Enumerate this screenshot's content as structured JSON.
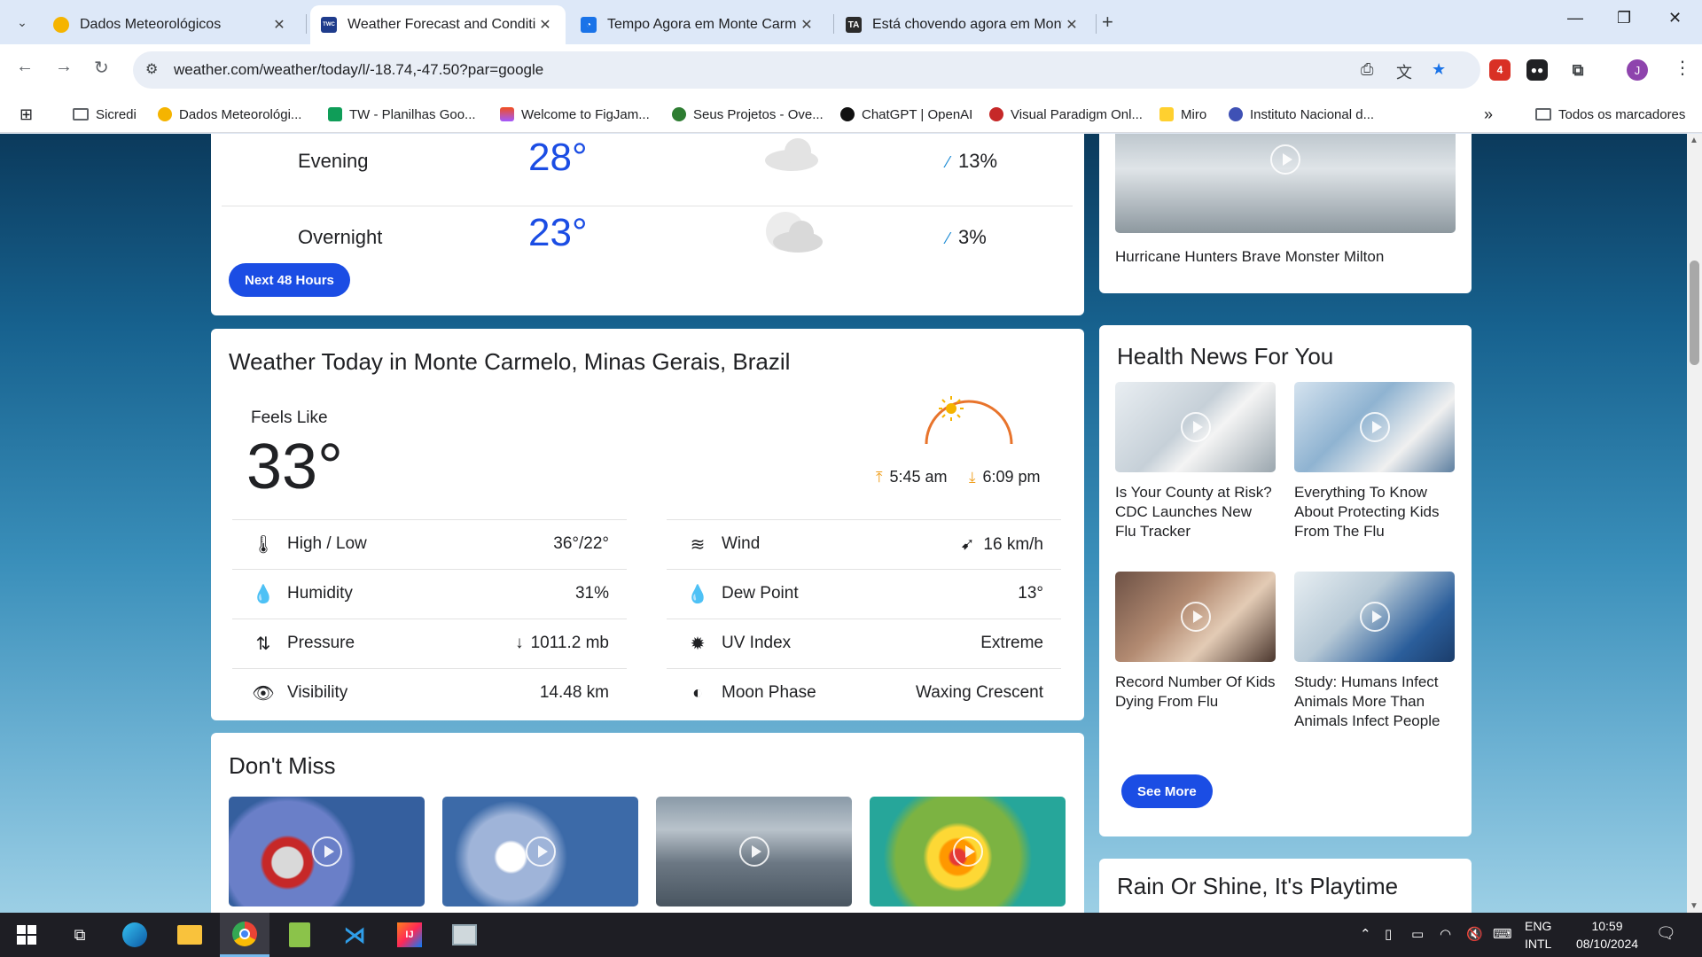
{
  "browser": {
    "tabs": [
      {
        "title": "Dados Meteorológicos",
        "favicon": "sun-cloud-icon",
        "active": false
      },
      {
        "title": "Weather Forecast and Condition",
        "favicon": "weather-channel-icon",
        "active": true
      },
      {
        "title": "Tempo Agora em Monte Carme",
        "favicon": "tempo-agora-icon",
        "active": false
      },
      {
        "title": "Está chovendo agora em Monte",
        "favicon": "ta-icon",
        "active": false
      }
    ],
    "url": "weather.com/weather/today/l/-18.74,-47.50?par=google",
    "bookmarks": [
      {
        "label": "Sicredi"
      },
      {
        "label": "Dados Meteorológi..."
      },
      {
        "label": "TW - Planilhas Goo..."
      },
      {
        "label": "Welcome to FigJam..."
      },
      {
        "label": "Seus Projetos - Ove..."
      },
      {
        "label": "ChatGPT | OpenAI"
      },
      {
        "label": "Visual Paradigm Onl..."
      },
      {
        "label": "Miro"
      },
      {
        "label": "Instituto Nacional d..."
      }
    ],
    "bookmarks_overflow": "»",
    "all_bookmarks": "Todos os marcadores",
    "extension_badge": "4",
    "profile_initial": "J"
  },
  "hourly": {
    "rows": [
      {
        "label": "Evening",
        "temp": "28°",
        "precip": "13%"
      },
      {
        "label": "Overnight",
        "temp": "23°",
        "precip": "3%"
      }
    ],
    "next_button": "Next 48 Hours"
  },
  "today": {
    "title": "Weather Today in Monte Carmelo, Minas Gerais, Brazil",
    "feels_like_label": "Feels Like",
    "feels_like_value": "33°",
    "sunrise": "5:45 am",
    "sunset": "6:09 pm",
    "left_details": [
      {
        "label": "High / Low",
        "value": "36°/22°",
        "icon": "thermometer-icon"
      },
      {
        "label": "Humidity",
        "value": "31%",
        "icon": "humidity-icon"
      },
      {
        "label": "Pressure",
        "value": "1011.2 mb",
        "icon": "pressure-icon"
      },
      {
        "label": "Visibility",
        "value": "14.48 km",
        "icon": "visibility-icon"
      }
    ],
    "right_details": [
      {
        "label": "Wind",
        "value": "16 km/h",
        "icon": "wind-icon"
      },
      {
        "label": "Dew Point",
        "value": "13°",
        "icon": "dew-point-icon"
      },
      {
        "label": "UV Index",
        "value": "Extreme",
        "icon": "uv-index-icon"
      },
      {
        "label": "Moon Phase",
        "value": "Waxing Crescent",
        "icon": "moon-phase-icon"
      }
    ]
  },
  "dont_miss": {
    "title": "Don't Miss"
  },
  "video_card": {
    "caption": "Hurricane Hunters Brave Monster Milton"
  },
  "health": {
    "title": "Health News For You",
    "items": [
      {
        "caption": "Is Your County at Risk? CDC Launches New Flu Tracker"
      },
      {
        "caption": "Everything To Know About Protecting Kids From The Flu"
      },
      {
        "caption": "Record Number Of Kids Dying From Flu"
      },
      {
        "caption": "Study: Humans Infect Animals More Than Animals Infect People"
      }
    ],
    "see_more": "See More"
  },
  "playtime": {
    "title": "Rain Or Shine, It's Playtime"
  },
  "taskbar": {
    "lang_top": "ENG",
    "lang_bottom": "INTL",
    "time": "10:59",
    "date": "08/10/2024"
  },
  "colors": {
    "accent": "#1b4de4",
    "temp_text": "#1b4de4",
    "sun_arc": "#e8742c"
  }
}
